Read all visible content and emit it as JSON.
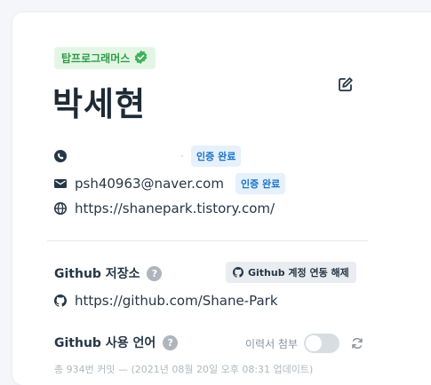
{
  "profile": {
    "badge": "탑프로그래머스",
    "name": "박세현"
  },
  "contact": {
    "verified_label": "인증 완료",
    "email": "psh40963@naver.com",
    "website": "https://shanepark.tistory.com/"
  },
  "github": {
    "repo_label": "Github 저장소",
    "unlink_label": "Github 계정 연동 해제",
    "url": "https://github.com/Shane-Park",
    "language_label": "Github 사용 언어",
    "resume_attach_label": "이력서 첨부",
    "commit_info": "총 934번 커밋 — (2021년 08월 20일 오후 08:31 업데이트)"
  },
  "icons": [
    "badge-check-icon",
    "edit-icon",
    "phone-icon",
    "mail-icon",
    "globe-icon",
    "help-icon",
    "github-icon",
    "refresh-icon"
  ],
  "colors": {
    "badge_bg": "#e3f6e5",
    "badge_fg": "#2e9c45",
    "verified_bg": "#e6f1fb",
    "verified_fg": "#1a73c8"
  }
}
